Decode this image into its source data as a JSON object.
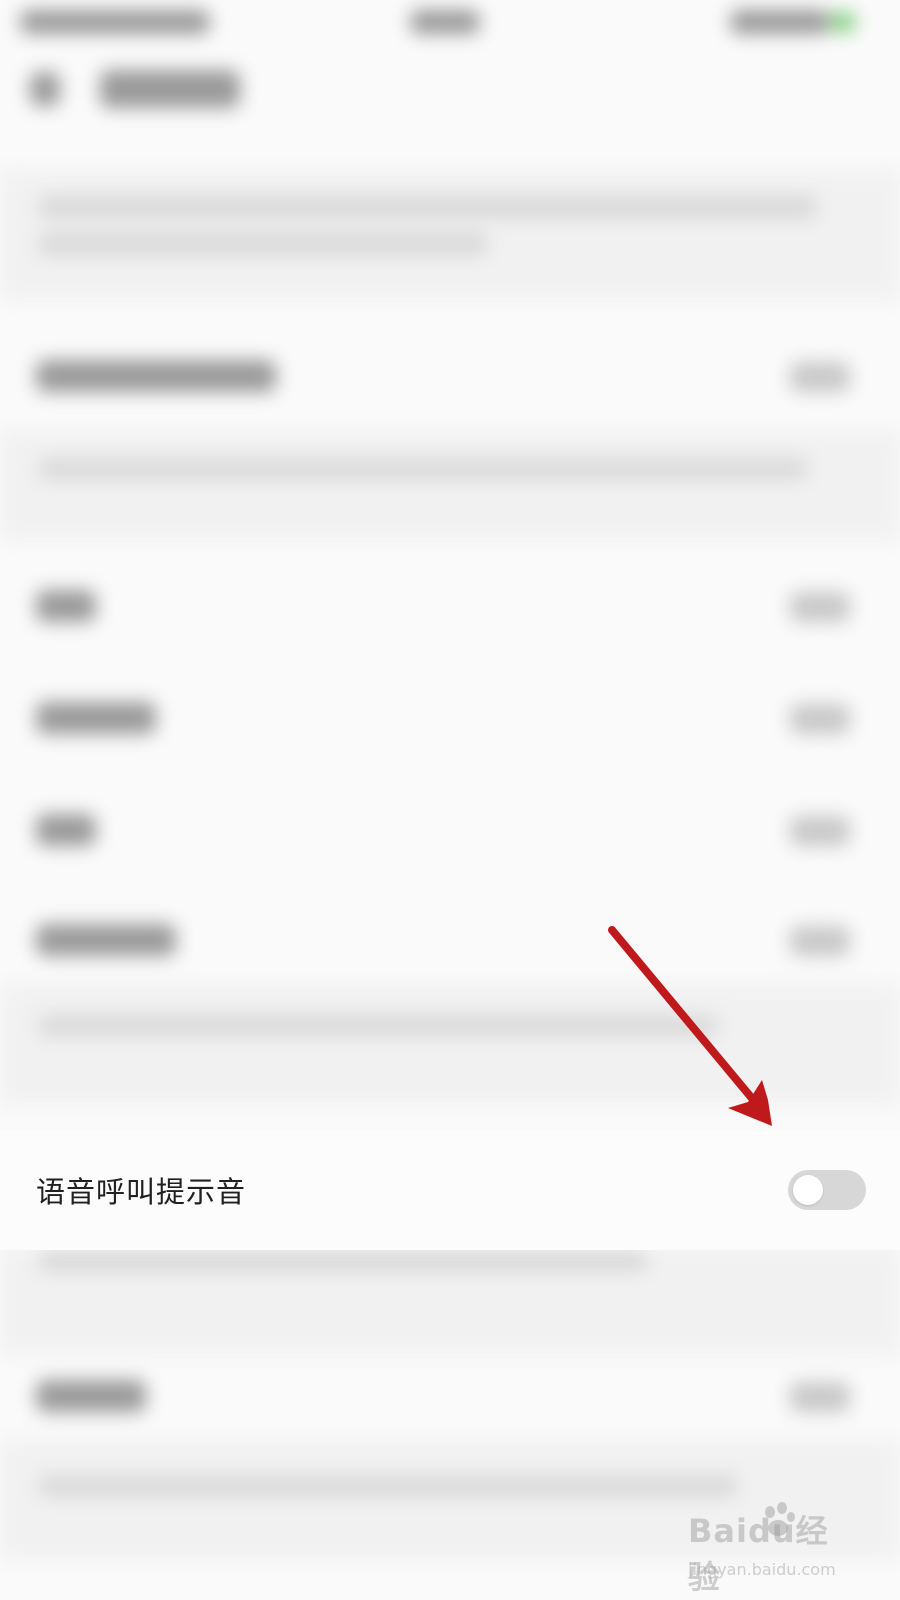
{
  "setting": {
    "label": "语音呼叫提示音",
    "toggle_on": false
  },
  "watermark": {
    "brand": "Baidu经验",
    "url": "jingyan.baidu.com"
  },
  "colors": {
    "arrow": "#c0191b",
    "toggle_off": "#d7d7d7"
  }
}
